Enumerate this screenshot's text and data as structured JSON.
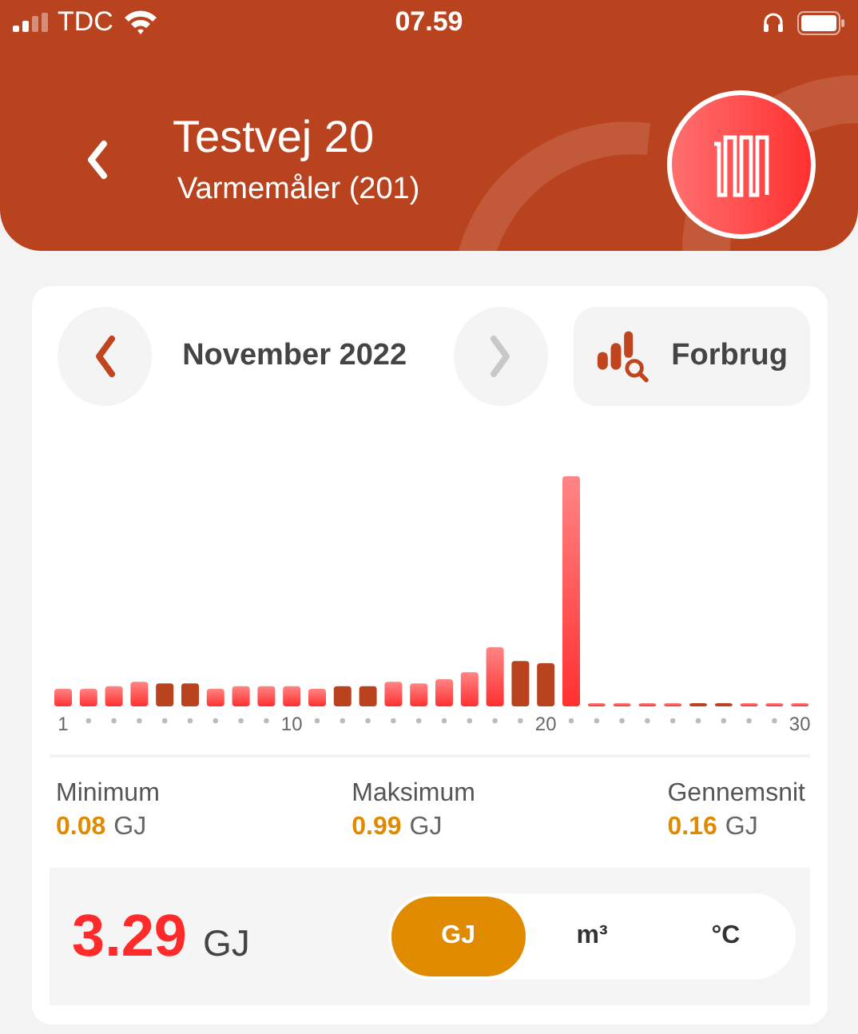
{
  "status_bar": {
    "carrier": "TDC",
    "time": "07.59"
  },
  "header": {
    "title": "Testvej 20",
    "subtitle": "Varmemåler (201)"
  },
  "period": {
    "label": "November 2022",
    "previous": {
      "disabled": false
    },
    "next": {
      "disabled": true
    }
  },
  "view_button": {
    "label": "Forbrug"
  },
  "chart": {
    "axis_labels": [
      "1",
      "10",
      "20",
      "30"
    ]
  },
  "stats": [
    {
      "label": "Minimum",
      "value": "0.08",
      "unit": "GJ"
    },
    {
      "label": "Maksimum",
      "value": "0.99",
      "unit": "GJ"
    },
    {
      "label": "Gennemsnit",
      "value": "0.16",
      "unit": "GJ"
    }
  ],
  "total": {
    "value": "3.29",
    "unit": "GJ"
  },
  "units": [
    {
      "label": "GJ",
      "selected": true
    },
    {
      "label": "m³",
      "selected": false
    },
    {
      "label": "°C",
      "selected": false
    }
  ]
}
